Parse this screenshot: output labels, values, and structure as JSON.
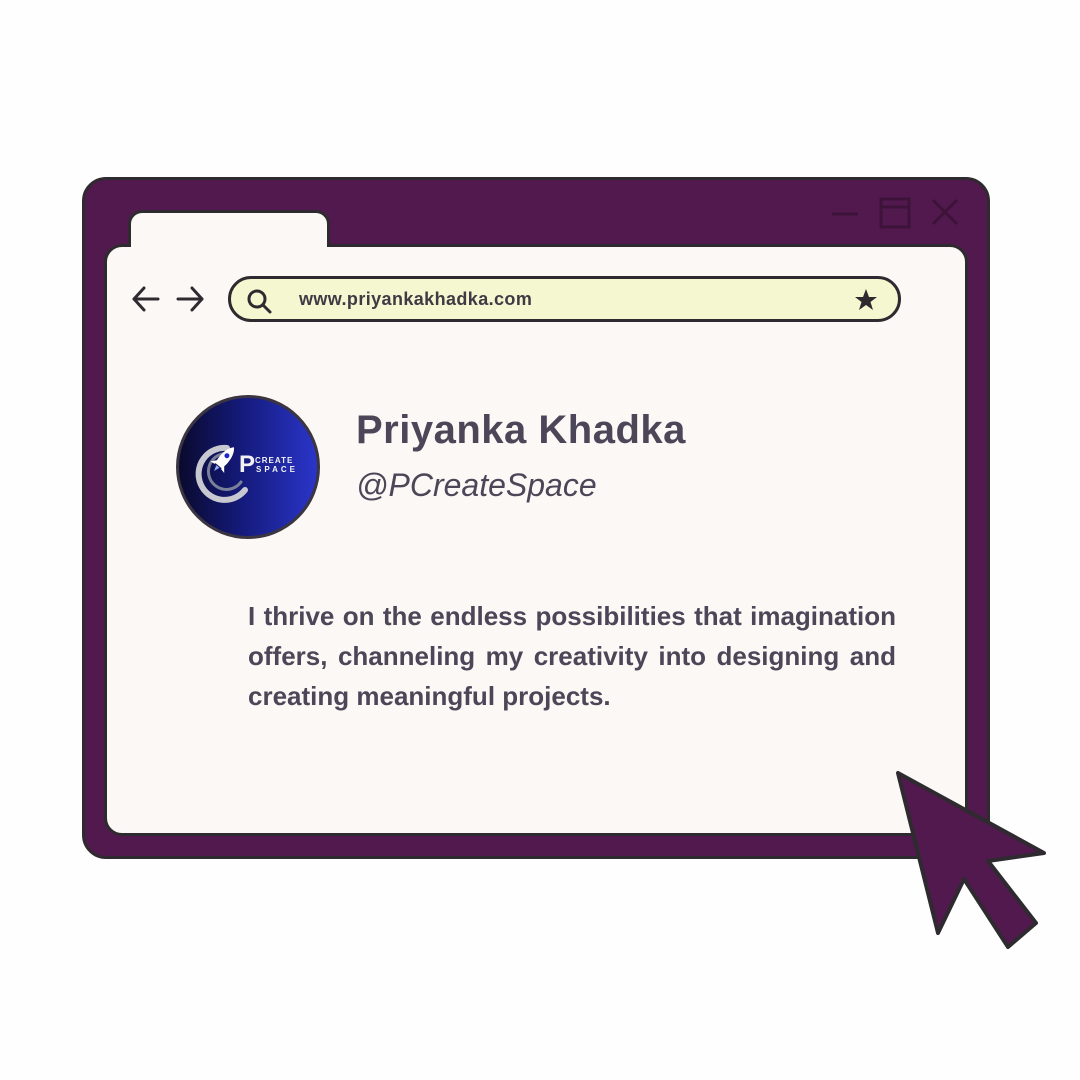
{
  "browser": {
    "address_bar": {
      "url": "www.priyankakhadka.com"
    },
    "nav": {
      "back_icon": "arrow-left-icon",
      "forward_icon": "arrow-right-icon"
    },
    "window_controls": [
      "minimize-icon",
      "maximize-icon",
      "close-icon"
    ]
  },
  "profile": {
    "name": "Priyanka Khadka",
    "handle": "@PCreateSpace",
    "avatar_logo": {
      "letter": "P",
      "word_top": "CREATE",
      "word_bottom": "SPACE"
    },
    "bio": "I thrive on the endless possibilities that imagination offers, channeling my creativity into designing and creating meaningful projects."
  },
  "colors": {
    "frame": "#52194f",
    "page": "#fcf8f5",
    "address_bar": "#f4f7cf",
    "text": "#4b4758",
    "outline": "#2f2a2f"
  }
}
